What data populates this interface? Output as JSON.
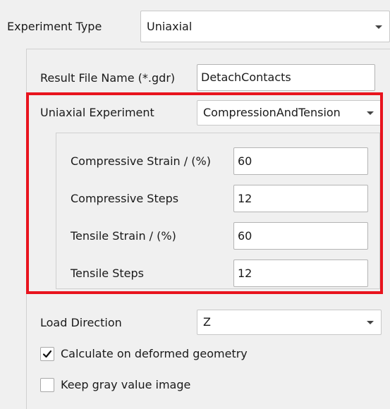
{
  "experiment_type": {
    "label": "Experiment Type",
    "value": "Uniaxial"
  },
  "result_file": {
    "label": "Result File Name (*.gdr)",
    "value": "DetachContacts"
  },
  "uniaxial_experiment": {
    "label": "Uniaxial Experiment",
    "value": "CompressionAndTension"
  },
  "params": {
    "compressive_strain": {
      "label": "Compressive Strain / (%)",
      "value": "60"
    },
    "compressive_steps": {
      "label": "Compressive Steps",
      "value": "12"
    },
    "tensile_strain": {
      "label": "Tensile Strain / (%)",
      "value": "60"
    },
    "tensile_steps": {
      "label": "Tensile Steps",
      "value": "12"
    }
  },
  "load_direction": {
    "label": "Load Direction",
    "value": "Z"
  },
  "options": {
    "deformed_geometry": {
      "label": "Calculate on deformed geometry",
      "checked": true
    },
    "keep_gray": {
      "label": "Keep gray value image",
      "checked": false
    }
  },
  "colors": {
    "panel_bg": "#f0f0f0",
    "highlight": "#e8141e"
  },
  "icons": {
    "dropdown": "chevron-down-icon",
    "check": "check-icon"
  }
}
